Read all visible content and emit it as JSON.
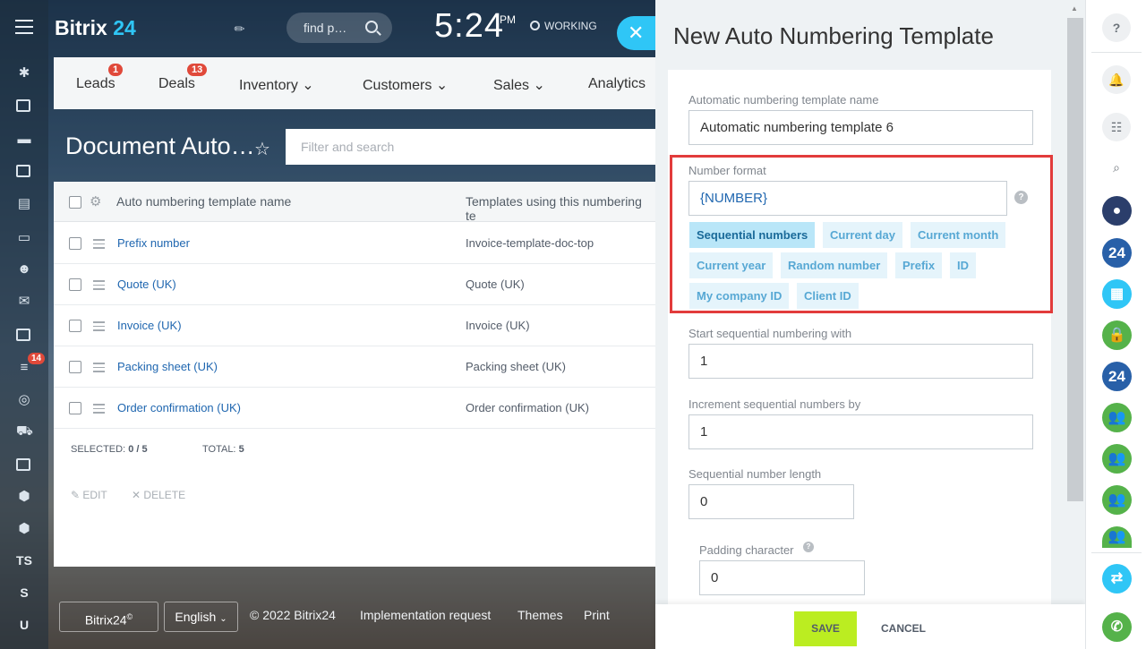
{
  "header": {
    "logo_main": "Bitrix",
    "logo_num": "24",
    "search_placeholder": "find p…",
    "time": "5:24",
    "ampm": "PM",
    "status": "WORKING"
  },
  "leftbar": {
    "badge_count": "14",
    "item_ts": "TS",
    "item_s": "S",
    "item_u": "U"
  },
  "crm_nav": {
    "items": [
      {
        "label": "Leads",
        "badge": "1"
      },
      {
        "label": "Deals",
        "badge": "13"
      },
      {
        "label": "Inventory"
      },
      {
        "label": "Customers"
      },
      {
        "label": "Sales"
      },
      {
        "label": "Analytics"
      }
    ]
  },
  "page": {
    "title": "Document Auto…",
    "filter_placeholder": "Filter and search"
  },
  "grid": {
    "columns": [
      "Auto numbering template name",
      "Templates using this numbering te"
    ],
    "rows": [
      {
        "name": "Prefix number",
        "templates": "Invoice-template-doc-top"
      },
      {
        "name": "Quote (UK)",
        "templates": "Quote (UK)"
      },
      {
        "name": "Invoice (UK)",
        "templates": "Invoice (UK)"
      },
      {
        "name": "Packing sheet (UK)",
        "templates": "Packing sheet (UK)"
      },
      {
        "name": "Order confirmation (UK)",
        "templates": "Order confirmation (UK)"
      }
    ],
    "selected_label": "SELECTED:",
    "selected_value": "0 / 5",
    "total_label": "TOTAL:",
    "total_value": "5",
    "edit_label": "EDIT",
    "delete_label": "DELETE"
  },
  "footer": {
    "logo": "Bitrix24",
    "logo_mark": "©",
    "language": "English",
    "copyright": "© 2022 Bitrix24",
    "implementation": "Implementation request",
    "themes": "Themes",
    "print": "Print"
  },
  "panel": {
    "title": "New Auto Numbering Template",
    "name_label": "Automatic numbering template name",
    "name_value": "Automatic numbering template  6",
    "format_label": "Number format",
    "format_value": "{NUMBER}",
    "chips": [
      "Sequential numbers",
      "Current day",
      "Current month",
      "Current year",
      "Random number",
      "Prefix",
      "ID",
      "My company ID",
      "Client ID"
    ],
    "start_label": "Start sequential numbering with",
    "start_value": "1",
    "increment_label": "Increment sequential numbers by",
    "increment_value": "1",
    "length_label": "Sequential number length",
    "length_value": "0",
    "padding_label": "Padding character",
    "padding_value": "0",
    "save_label": "SAVE",
    "cancel_label": "CANCEL"
  },
  "rightbar": {
    "help": "?",
    "b24_a": "24",
    "b24_b": "24"
  },
  "colors": {
    "accent": "#2fc6f6",
    "save": "#bbed21",
    "highlight": "#e23b3b",
    "badge": "#e0493a",
    "link": "#2067b0"
  }
}
